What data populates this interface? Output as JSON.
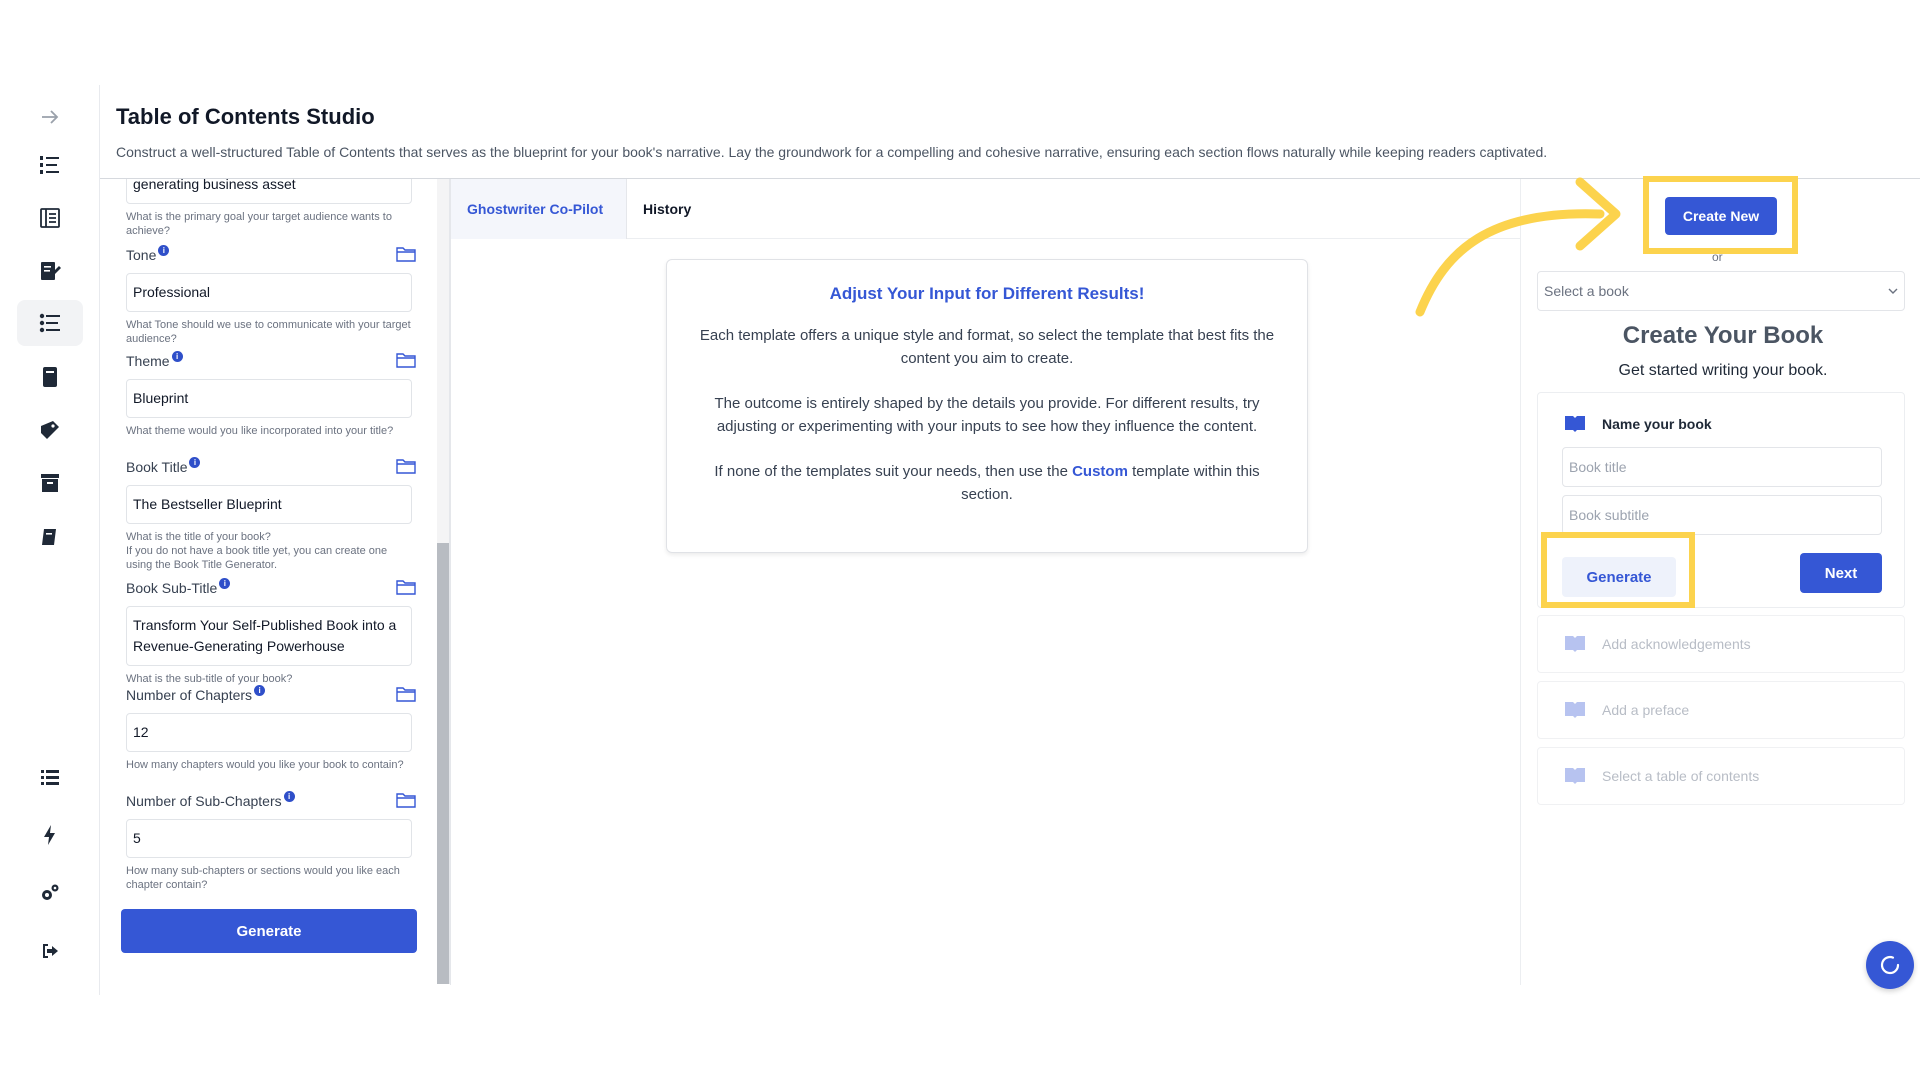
{
  "header": {
    "title": "Table of Contents Studio",
    "description": "Construct a well-structured Table of Contents that serves as the blueprint for your book's narrative. Lay the groundwork for a compelling and cohesive narrative, ensuring each section flows naturally while keeping readers captivated."
  },
  "rail": {
    "icons": [
      "arrow-right-icon",
      "numbered-list-icon",
      "book-open-icon",
      "pen-note-icon",
      "toc-list-icon",
      "book-stack-icon",
      "book-tag-icon",
      "archive-icon",
      "book-closed-icon",
      "list-icon",
      "bolt-icon",
      "gears-icon",
      "logout-icon"
    ],
    "active": "toc-list-icon"
  },
  "form": {
    "partial_value": "generating business asset",
    "partial_help": "What is the primary goal your target audience wants to achieve?",
    "fields": [
      {
        "label": "Tone",
        "value": "Professional",
        "help": "What Tone should we use to communicate with your target audience?"
      },
      {
        "label": "Theme",
        "value": "Blueprint",
        "help": "What theme would you like incorporated into your title?"
      },
      {
        "label": "Book Title",
        "value": "The Bestseller Blueprint",
        "help": "What is the title of your book?",
        "help2": "If you do not have a book title yet, you can create one using the Book Title Generator."
      },
      {
        "label": "Book Sub-Title",
        "value": "Transform Your Self-Published Book into a Revenue-Generating Powerhouse",
        "help": "What is the sub-title of your book?"
      },
      {
        "label": "Number of Chapters",
        "value": "12",
        "help": "How many chapters would you like your book to contain?"
      },
      {
        "label": "Number of Sub-Chapters",
        "value": "5",
        "help": "How many sub-chapters or sections would you like each chapter contain?"
      }
    ],
    "generate_label": "Generate"
  },
  "tabs": {
    "copilot": "Ghostwriter Co-Pilot",
    "history": "History"
  },
  "info_card": {
    "title": "Adjust Your Input for Different Results!",
    "p1": "Each template offers a unique style and format, so select the template that best fits the content you aim to create.",
    "p2": "The outcome is entirely shaped by the details you provide. For different results, try adjusting or experimenting with your inputs to see how they influence the content.",
    "p3_pre": "If none of the templates suit your needs, then use the ",
    "p3_link": "Custom",
    "p3_post": " template within this section."
  },
  "right": {
    "create_new": "Create New",
    "or": "or",
    "select_placeholder": "Select a book",
    "title": "Create Your Book",
    "subtitle": "Get started writing your book.",
    "step_name": "Name your book",
    "book_title_placeholder": "Book title",
    "book_subtitle_placeholder": "Book subtitle",
    "generate": "Generate",
    "next": "Next",
    "step_ack": "Add acknowledgements",
    "step_preface": "Add a preface",
    "step_toc": "Select a table of contents"
  },
  "colors": {
    "accent": "#3557d5",
    "highlight": "#fcd34d"
  }
}
